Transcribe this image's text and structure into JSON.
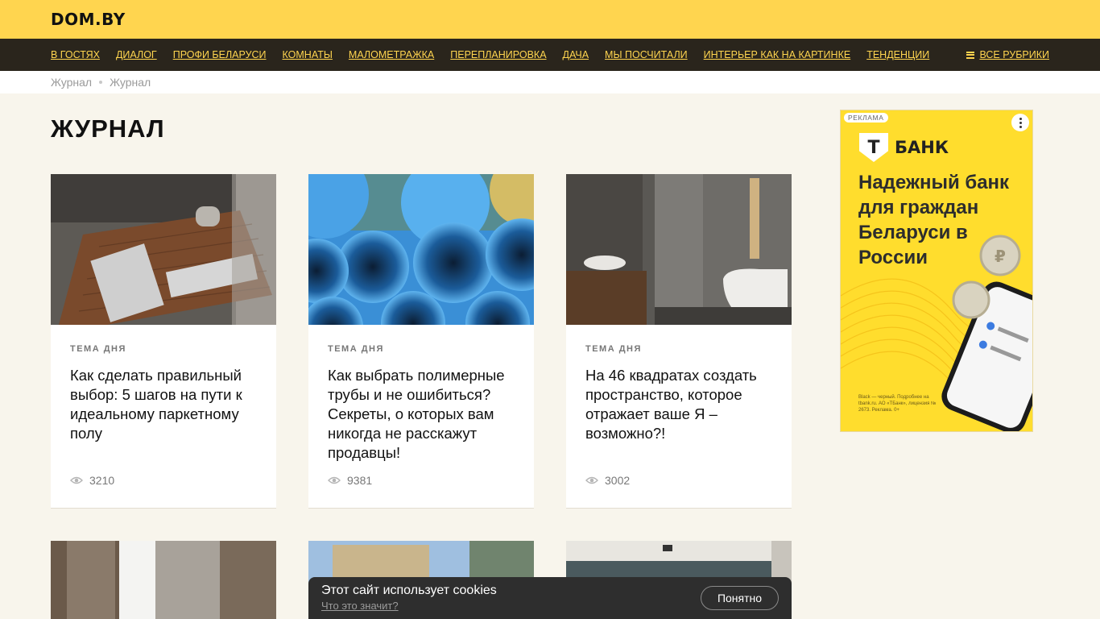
{
  "header": {
    "logo": "DOM.BY"
  },
  "nav": {
    "items": [
      "В ГОСТЯХ",
      "ДИАЛОГ",
      "ПРОФИ БЕЛАРУСИ",
      "КОМНАТЫ",
      "МАЛОМЕТРАЖКА",
      "ПЕРЕПЛАНИРОВКА",
      "ДАЧА",
      "МЫ ПОСЧИТАЛИ",
      "ИНТЕРЬЕР КАК НА КАРТИНКЕ",
      "ТЕНДЕНЦИИ"
    ],
    "all_rubrics": "ВСЕ РУБРИКИ",
    "accent_color": "#ffd54f"
  },
  "breadcrumb": [
    "Журнал",
    "Журнал"
  ],
  "page": {
    "title": "ЖУРНАЛ"
  },
  "cards": [
    {
      "tag": "ТЕМА ДНЯ",
      "title": "Как сделать правильный выбор: 5 шагов на пути к идеальному паркетному полу",
      "views": "3210",
      "image": "living-room-parquet-photo"
    },
    {
      "tag": "ТЕМА ДНЯ",
      "title": "Как выбрать полимерные трубы и не ошибиться? Секреты, о которых вам никогда не расскажут продавцы!",
      "views": "9381",
      "image": "blue-pipes-photo"
    },
    {
      "tag": "ТЕМА ДНЯ",
      "title": "На 46 квадратах создать пространство, которое отражает ваше Я – возможно?!",
      "views": "3002",
      "image": "bathroom-photo"
    }
  ],
  "ad": {
    "label": "РЕКЛАМА",
    "brand_letter": "Т",
    "brand": "БАНК",
    "headline": "Надежный банк для граждан Беларуси в России",
    "fine_print": "Black — черный. Подробнее на tbank.ru. АО «ТБанк», лицензия № 2673. Реклама. 0+",
    "color": "#ffdd2d"
  },
  "cookie": {
    "text": "Этот сайт использует cookies",
    "link": "Что это значит?",
    "button": "Понятно"
  }
}
